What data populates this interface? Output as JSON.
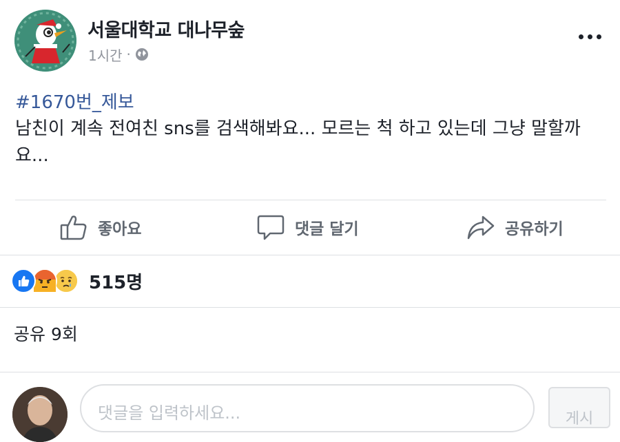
{
  "post": {
    "page_name": "서울대학교 대나무숲",
    "time": "1시간",
    "separator": "·",
    "hashtag": "#1670번_제보",
    "body": "남친이 계속 전여친 sns를 검색해봐요... 모르는 척 하고 있는데 그냥 말할까요..."
  },
  "actions": {
    "like_label": "좋아요",
    "comment_label": "댓글 달기",
    "share_label": "공유하기"
  },
  "reactions": {
    "types": [
      "like-icon",
      "angry-icon",
      "sad-icon"
    ],
    "count_label": "515명"
  },
  "shares": {
    "label": "공유 9회"
  },
  "comment_input": {
    "placeholder": "댓글을 입력하세요...",
    "post_label": "게시"
  },
  "colors": {
    "link": "#365899",
    "text": "#1d2129",
    "muted": "#90949c",
    "action": "#606770",
    "like_blue": "#1877f2",
    "divider": "#dddfe2"
  }
}
